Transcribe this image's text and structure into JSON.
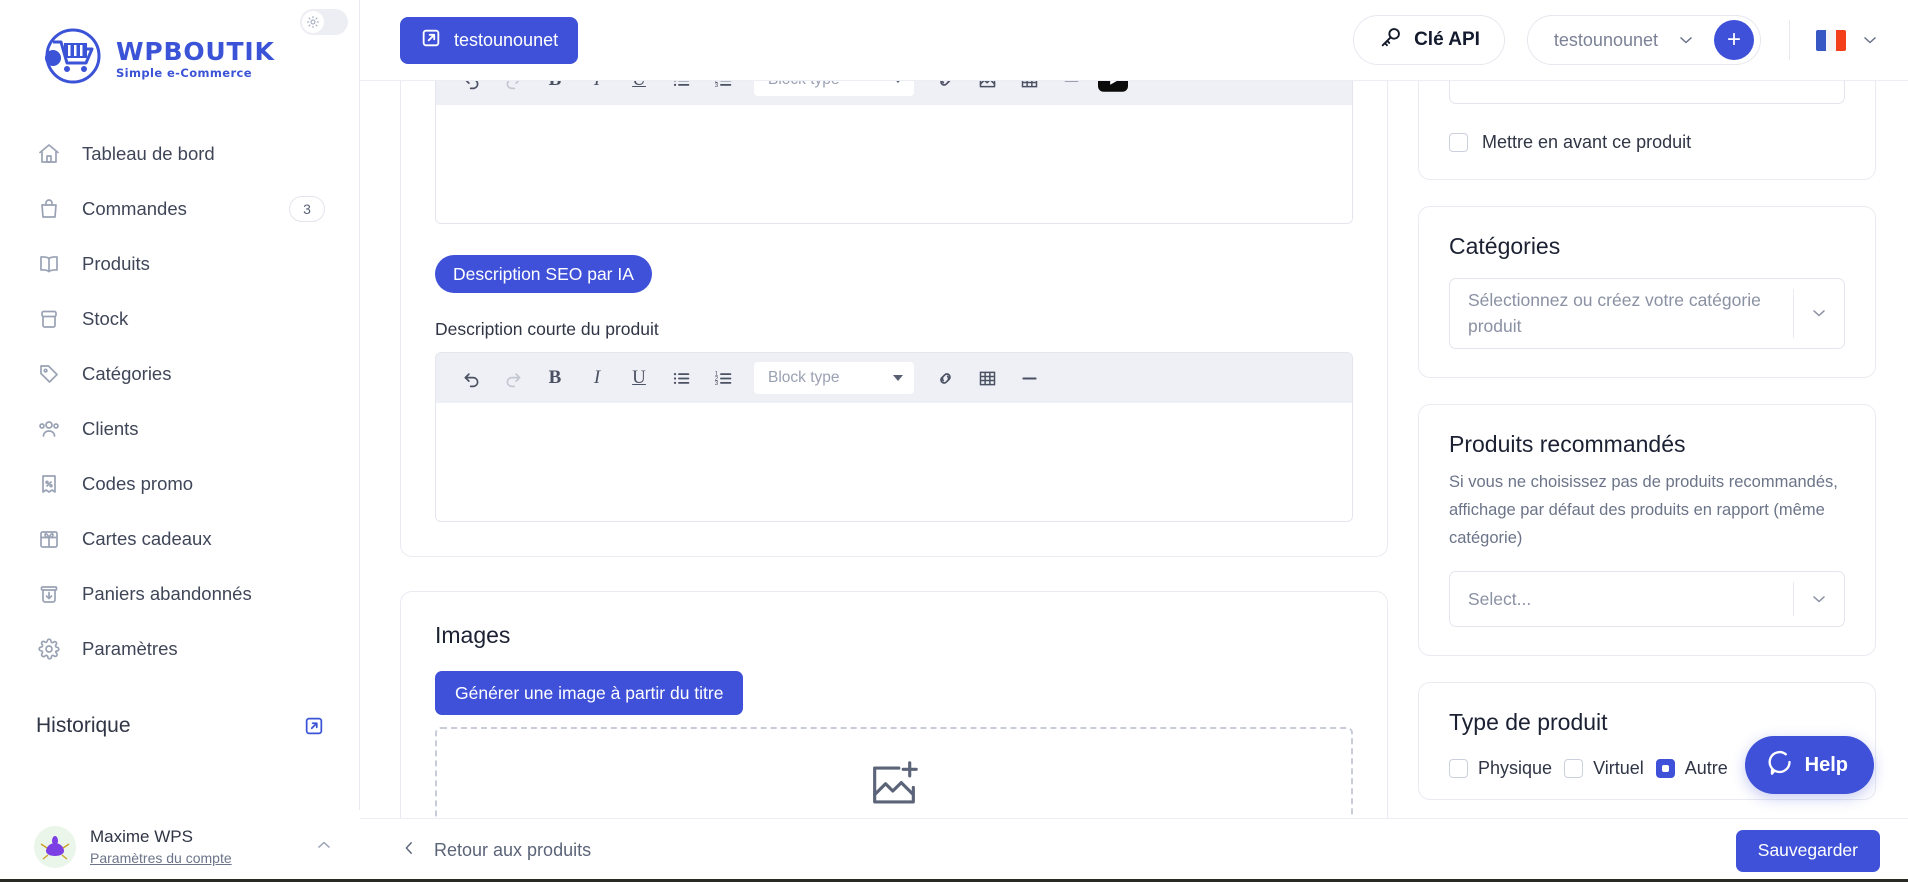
{
  "brand": {
    "name": "WPBOUTIK",
    "tagline": "Simple e-Commerce",
    "accent": "#3f51d8"
  },
  "sidebar": {
    "items": [
      {
        "label": "Tableau de bord",
        "icon": "home-icon",
        "badge": ""
      },
      {
        "label": "Commandes",
        "icon": "bag-icon",
        "badge": "3"
      },
      {
        "label": "Produits",
        "icon": "book-icon",
        "badge": ""
      },
      {
        "label": "Stock",
        "icon": "box-icon",
        "badge": ""
      },
      {
        "label": "Catégories",
        "icon": "tag-icon",
        "badge": ""
      },
      {
        "label": "Clients",
        "icon": "users-icon",
        "badge": ""
      },
      {
        "label": "Codes promo",
        "icon": "percent-ticket-icon",
        "badge": ""
      },
      {
        "label": "Cartes cadeaux",
        "icon": "gift-icon",
        "badge": ""
      },
      {
        "label": "Paniers abandonnés",
        "icon": "abandoned-cart-icon",
        "badge": ""
      },
      {
        "label": "Paramètres",
        "icon": "gear-icon",
        "badge": ""
      }
    ],
    "history_label": "Historique",
    "user": {
      "name": "Maxime WPS",
      "subtitle": "Paramètres du compte"
    }
  },
  "topbar": {
    "shop_button": "testounounet",
    "api_key_button": "Clé API",
    "store_selected": "testounounet",
    "add_button": "+",
    "language": "fr"
  },
  "editor_main": {
    "toolbar": {
      "undo": "undo-icon",
      "redo": "redo-icon",
      "bold": "B",
      "italic": "I",
      "underline": "U",
      "block_type_placeholder": "Block type"
    }
  },
  "main": {
    "seo_button": "Description SEO par IA",
    "short_description_label": "Description courte du produit",
    "images_title": "Images",
    "generate_image_button": "Générer une image à partir du titre"
  },
  "side": {
    "featured_checkbox_label": "Mettre en avant ce produit",
    "categories": {
      "title": "Catégories",
      "select_placeholder": "Sélectionnez ou créez votre catégorie produit"
    },
    "recommended": {
      "title": "Produits recommandés",
      "description": "Si vous ne choisissez pas de produits recommandés, affichage par défaut des produits en rapport (même catégorie)",
      "select_placeholder": "Select..."
    },
    "product_type": {
      "title": "Type de produit",
      "options": [
        {
          "label": "Physique",
          "selected": false
        },
        {
          "label": "Virtuel",
          "selected": false
        },
        {
          "label": "Autre",
          "selected": true
        }
      ]
    }
  },
  "bottombar": {
    "back_label": "Retour aux produits",
    "save_label": "Sauvegarder"
  },
  "help": {
    "label": "Help"
  }
}
